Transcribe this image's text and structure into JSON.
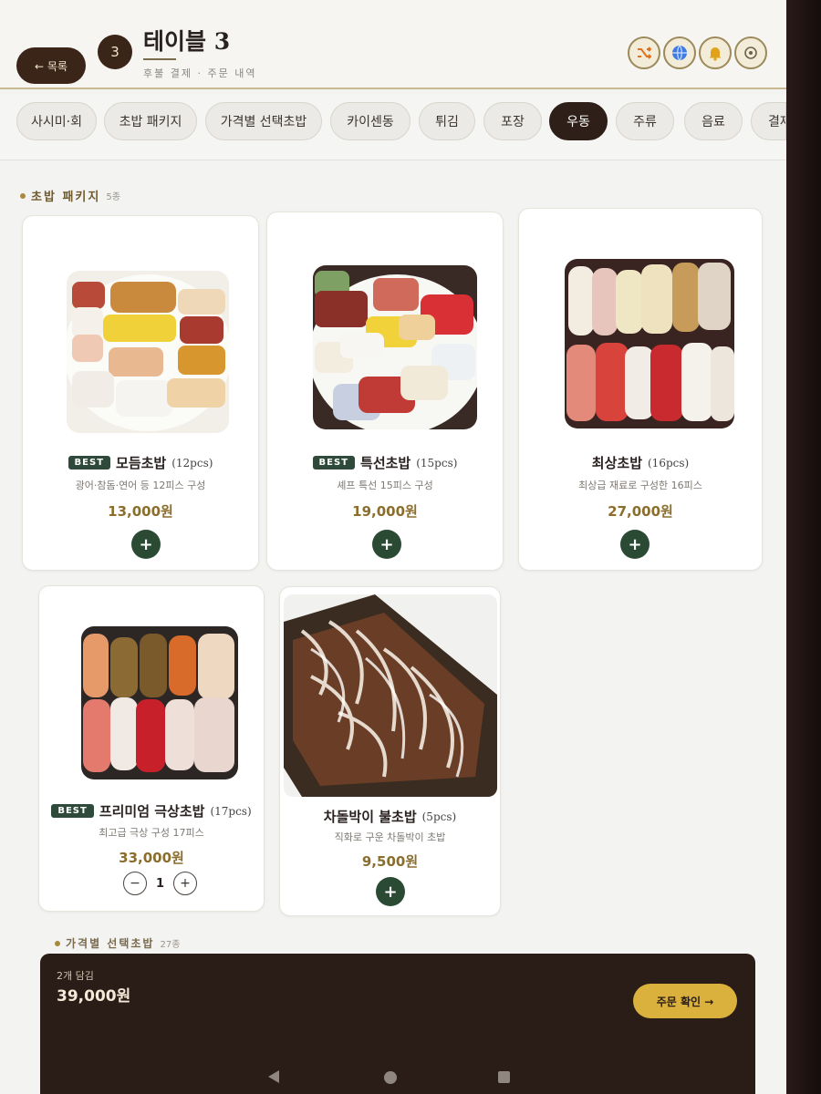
{
  "header": {
    "back_label": "← 목록",
    "table_number": "3",
    "title": "테이블 3",
    "subtitle": "후불 결제 · 주문 내역",
    "icons": [
      "shuffle-icon",
      "globe-icon",
      "bell-icon",
      "settings-icon"
    ]
  },
  "tabs": [
    "사시미·회",
    "초밥 패키지",
    "가격별 선택초밥",
    "카이센동",
    "튀김",
    "포장",
    "우동",
    "주류",
    "음료",
    "결제"
  ],
  "active_tab": "우동",
  "section": {
    "title": "초밥 패키지",
    "count": "5종"
  },
  "section2": {
    "title": "가격별 선택초밥",
    "count": "27종"
  },
  "items": [
    {
      "best": "BEST",
      "name": "모듬초밥",
      "pcs": "(12pcs)",
      "desc": "광어·참돔·연어 등 12피스 구성",
      "price": "13,000원",
      "add": "+"
    },
    {
      "best": "BEST",
      "name": "특선초밥",
      "pcs": "(15pcs)",
      "desc": "셰프 특선 15피스 구성",
      "price": "19,000원",
      "add": "+"
    },
    {
      "best": "",
      "name": "최상초밥",
      "pcs": "(16pcs)",
      "desc": "최상급 재료로 구성한 16피스",
      "price": "27,000원",
      "add": "+"
    },
    {
      "best": "BEST",
      "name": "프리미엄 극상초밥",
      "pcs": "(17pcs)",
      "desc": "최고급 극상 구성 17피스",
      "price": "33,000원",
      "qty": "1",
      "minus": "−",
      "plus": "+"
    },
    {
      "best": "",
      "name": "차돌박이 불초밥",
      "pcs": "(5pcs)",
      "desc": "직화로 구운 차돌박이 초밥",
      "price": "9,500원",
      "add": "+"
    }
  ],
  "cart": {
    "count_label": "2개 담김",
    "total": "39,000원",
    "order_label": "주문 확인 →"
  },
  "colors": {
    "accent_dark": "#2e1f18",
    "add_button": "#2b4a34",
    "price": "#8b6e2e",
    "order_button": "#d9b13c"
  }
}
